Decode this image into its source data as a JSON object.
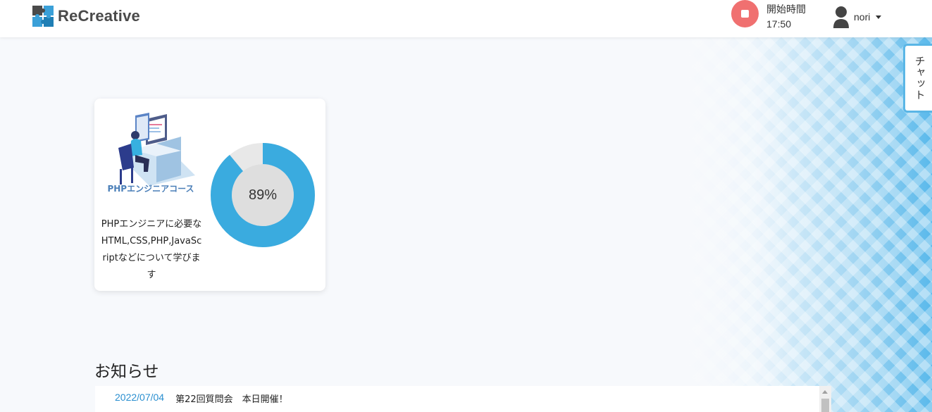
{
  "header": {
    "logo_text": "ReCreative",
    "timer_label": "開始時間",
    "timer_value": "17:50",
    "user_name": "nori"
  },
  "chat_tab": {
    "label": "チャット"
  },
  "course": {
    "name": "PHPエンジニアコース",
    "description": "PHPエンジニアに必要なHTML,CSS,PHP,JavaScriptなどについて学びます",
    "progress_percent": 89,
    "progress_label": "89%",
    "progress_color": "#3aabdf",
    "track_color": "#e8e8e8",
    "inner_color": "#dedede"
  },
  "news": {
    "title": "お知らせ",
    "items": [
      {
        "date": "2022/07/04",
        "text": "第22回質問会　本日開催！"
      }
    ]
  },
  "colors": {
    "accent": "#3aabdf",
    "stop_button": "#f07070",
    "logo": "#4a4a4a"
  }
}
